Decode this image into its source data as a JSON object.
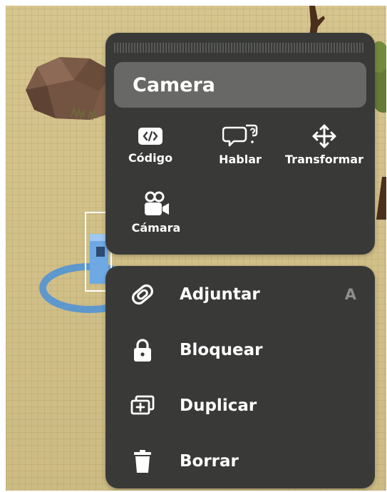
{
  "object_menu": {
    "title": "Camera",
    "tools": [
      {
        "label": "Código",
        "icon": "code-icon"
      },
      {
        "label": "Hablar",
        "icon": "speech-bubble-icon"
      },
      {
        "label": "Transformar",
        "icon": "move-arrows-icon"
      },
      {
        "label": "Cámara",
        "icon": "video-camera-icon"
      }
    ]
  },
  "actions": [
    {
      "label": "Adjuntar",
      "icon": "attach-icon",
      "shortcut": "A"
    },
    {
      "label": "Bloquear",
      "icon": "lock-icon"
    },
    {
      "label": "Duplicar",
      "icon": "duplicate-icon"
    },
    {
      "label": "Borrar",
      "icon": "trash-icon"
    }
  ],
  "colors": {
    "panel_bg": "#393a38",
    "title_bar_bg": "#686966",
    "text": "#ffffff",
    "shortcut_text": "#8e8f8c",
    "ground": "#d3c18a",
    "selection_ring": "#4a90d9"
  }
}
